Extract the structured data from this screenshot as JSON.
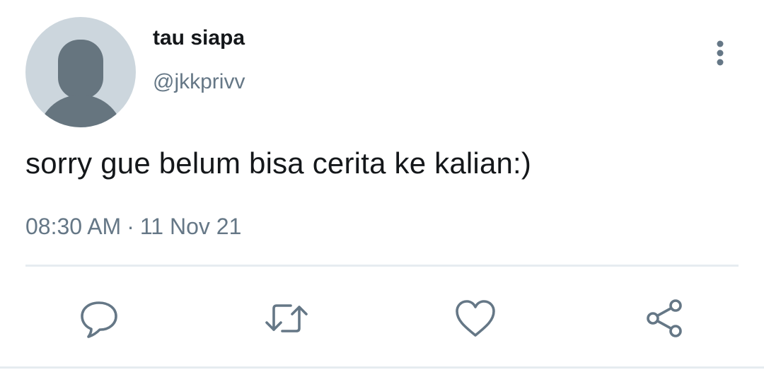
{
  "tweet": {
    "display_name": "tau siapa",
    "handle": "@jkkprivv",
    "text": "sorry gue belum bisa cerita ke kalian:)",
    "time": "08:30 AM",
    "separator": "·",
    "date": "11 Nov 21"
  },
  "icons": {
    "avatar": "default-avatar-icon",
    "more": "more-vertical-icon",
    "reply": "reply-icon",
    "retweet": "retweet-icon",
    "like": "heart-icon",
    "share": "share-icon"
  },
  "colors": {
    "primary_text": "#14171a",
    "secondary_text": "#657786",
    "icon": "#657786",
    "divider": "#e6ecf0",
    "avatar_bg": "#ccd6dd",
    "avatar_fg": "#66757f"
  }
}
